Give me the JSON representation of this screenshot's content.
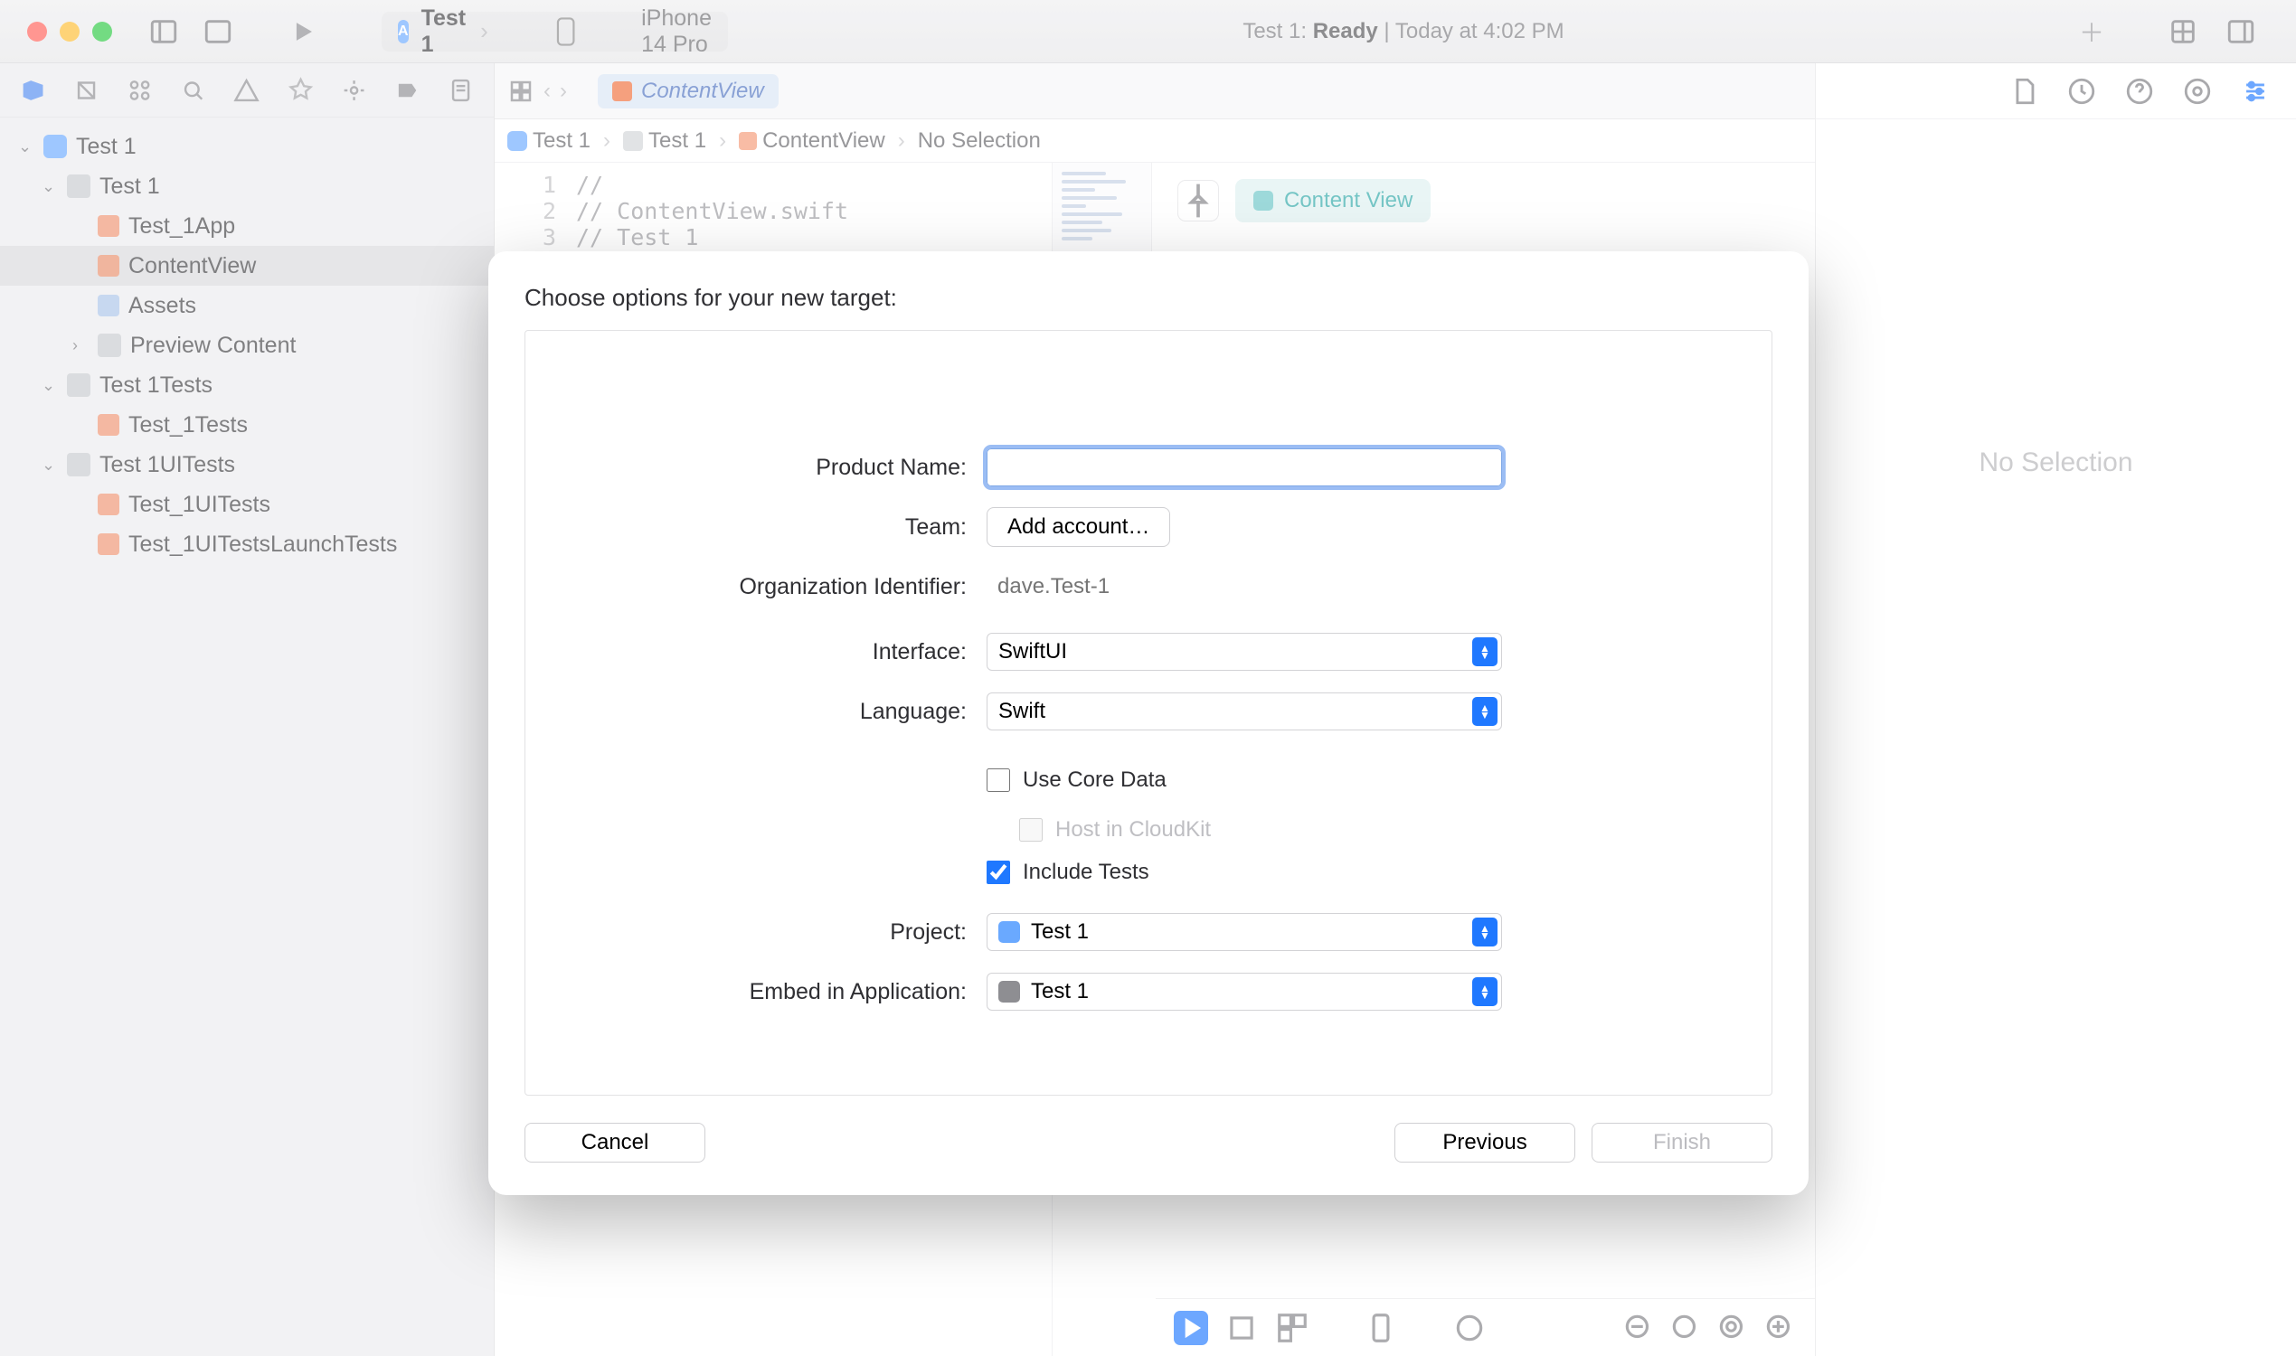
{
  "titlebar": {
    "scheme_project": "Test 1",
    "scheme_device": "iPhone 14 Pro",
    "status_project": "Test 1:",
    "status_state": "Ready",
    "status_sep": " | ",
    "status_time": "Today at 4:02 PM"
  },
  "tabrow": {
    "active_tab": "ContentView"
  },
  "crumbs": {
    "a": "Test 1",
    "b": "Test 1",
    "c": "ContentView",
    "d": "No Selection"
  },
  "sidebar": {
    "root": "Test 1",
    "grp_app": "Test 1",
    "file_app": "Test_1App",
    "file_cv": "ContentView",
    "file_assets": "Assets",
    "grp_preview": "Preview Content",
    "grp_tests": "Test 1Tests",
    "file_tests": "Test_1Tests",
    "grp_uitests": "Test 1UITests",
    "file_uitests": "Test_1UITests",
    "file_uitests_launch": "Test_1UITestsLaunchTests"
  },
  "code": {
    "l1": "//",
    "l2": "//  ContentView.swift",
    "l3": "//  Test 1"
  },
  "canvas": {
    "chip": "Content View"
  },
  "inspector": {
    "empty": "No Selection"
  },
  "modal": {
    "title": "Choose options for your new target:",
    "labels": {
      "product": "Product Name:",
      "team": "Team:",
      "org": "Organization Identifier:",
      "interface": "Interface:",
      "language": "Language:",
      "project": "Project:",
      "embed": "Embed in Application:"
    },
    "values": {
      "product": "",
      "team_btn": "Add account…",
      "org_placeholder": "dave.Test-1",
      "interface": "SwiftUI",
      "language": "Swift",
      "core_data": "Use Core Data",
      "cloudkit": "Host in CloudKit",
      "include_tests": "Include Tests",
      "project": "Test 1",
      "embed": "Test 1"
    },
    "buttons": {
      "cancel": "Cancel",
      "previous": "Previous",
      "finish": "Finish"
    }
  }
}
